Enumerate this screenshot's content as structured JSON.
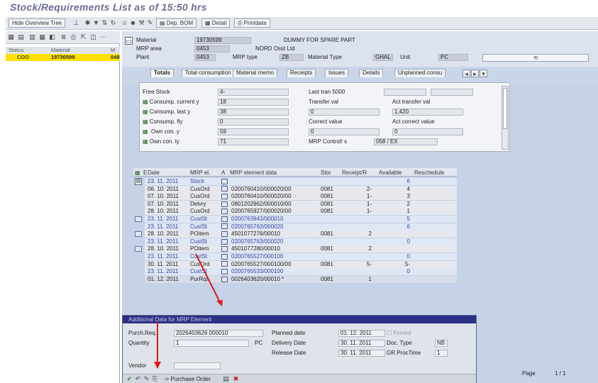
{
  "window": {
    "title": "Stock/Requirements List as of 15:50 hrs"
  },
  "toolbar": {
    "hide_overview_label": "Hide Overview Tree",
    "dep_bom_label": "Dep. BOM",
    "detail_label": "Detail",
    "printed_label": "Printdata"
  },
  "tree": {
    "col_status": "Status",
    "col_material": "Material",
    "col_m": "M",
    "row": {
      "status": "COO",
      "material": "19730599",
      "m": "048"
    }
  },
  "header": {
    "material_label": "Material",
    "material_value": "19730599",
    "material_desc": "DUMMY FOR SPARE PART",
    "mrp_area_label": "MRP area",
    "mrp_area_value": "0453",
    "mrp_area_desc": "NORD Osst Ltd",
    "plant_label": "Plant",
    "plant_value": "0453",
    "mrp_type_label": "MRP type",
    "mrp_type_value": "ZB",
    "material_type_label": "Material Type",
    "material_type_value": "GHAL",
    "unit_label": "Unit",
    "unit_value": "PC"
  },
  "tabs": [
    "Totals",
    "Total consumption",
    "Material memo",
    "Receipts",
    "Issues",
    "Details",
    "Unplanned consu"
  ],
  "totals": {
    "rows": [
      {
        "label": "Free Stock",
        "value": "4-",
        "label2": "Last tran 5000",
        "value2": ""
      },
      {
        "label": "Consump. current y",
        "value": "18",
        "label2": "Transfer val",
        "value2": "Act transfer val"
      },
      {
        "label": "Consump. last y",
        "value": "38",
        "label2": "0",
        "value2": "1,420"
      },
      {
        "label": "Consump. fly",
        "value": "0",
        "label2": "Correct value",
        "value2": "Act correct value"
      },
      {
        "label": "Own con. y",
        "value": "59",
        "label2": "0",
        "value2": "0"
      },
      {
        "label": "Own con. ly",
        "value": "71",
        "label2": "MRP Control! s",
        "value2": "058  /  EX"
      }
    ]
  },
  "grid": {
    "headers": {
      "e": "E",
      "date": "Date",
      "mrp_el": "MRP el.",
      "a": "A",
      "data": "MRP element data",
      "stor": "Stor",
      "receipt": "Receipt/R",
      "avail": "Available",
      "resched": "Reschedule"
    },
    "rows": [
      {
        "date": "23. 11. 2011",
        "mrp": "Stock",
        "data": "",
        "stor": "",
        "rec": "",
        "avail": "6",
        "blue": true
      },
      {
        "date": "06. 10. 2011",
        "mrp": "CusOrd",
        "data": "0200760410/000020/00",
        "stor": "0081",
        "rec": "2-",
        "avail": "4",
        "blue": false
      },
      {
        "date": "07. 10. 2011",
        "mrp": "CusOrd",
        "data": "0200760410/000020/00",
        "stor": "0081",
        "rec": "1-",
        "avail": "3",
        "blue": false
      },
      {
        "date": "07. 10. 2011",
        "mrp": "Delvry",
        "data": "0801202962/000010/00",
        "stor": "0081",
        "rec": "1-",
        "avail": "2",
        "blue": false
      },
      {
        "date": "28. 10. 2011",
        "mrp": "CusOrd",
        "data": "0200765927/000020/00",
        "stor": "0081",
        "rec": "1-",
        "avail": "1",
        "blue": false
      },
      {
        "date": "23. 11. 2011",
        "mrp": "CustSt",
        "data": "0200763943/000010",
        "stor": "",
        "rec": "",
        "avail": "5",
        "blue": true
      },
      {
        "date": "23. 11. 2011",
        "mrp": "CustSt",
        "data": "0200765763/000020",
        "stor": "",
        "rec": "",
        "avail": "6",
        "blue": true
      },
      {
        "date": "28. 10. 2011",
        "mrp": "POitem",
        "data": "4501077276/00010",
        "stor": "0081",
        "rec": "2",
        "avail": "",
        "blue": false
      },
      {
        "date": "23. 11. 2011",
        "mrp": "CustSt",
        "data": "0200765763/000020",
        "stor": "",
        "rec": "",
        "avail": "0",
        "blue": true
      },
      {
        "date": "28. 10. 2011",
        "mrp": "POitem",
        "data": "4501077280/00010",
        "stor": "0081",
        "rec": "2",
        "avail": "",
        "blue": false
      },
      {
        "date": "23. 11. 2011",
        "mrp": "CustSt",
        "data": "0200765527/000100",
        "stor": "",
        "rec": "",
        "avail": "0",
        "blue": true
      },
      {
        "date": "30. 11. 2011",
        "mrp": "CusOrd",
        "data": "0200765527/000100/00",
        "stor": "0081",
        "rec": "5-",
        "avail": "5-",
        "blue": false
      },
      {
        "date": "23. 11. 2011",
        "mrp": "CustSt",
        "data": "0200765533/000100",
        "stor": "",
        "rec": "",
        "avail": "0",
        "blue": true
      },
      {
        "date": "01. 12. 2011",
        "mrp": "PurRqs",
        "data": "0026403620/00010  *",
        "stor": "0081",
        "rec": "1",
        "avail": "",
        "blue": false
      }
    ]
  },
  "popup": {
    "title": "Additional Data for MRP Element",
    "purch_req_label": "Purch.Req.",
    "purch_req_value": "2026403626  000010",
    "quantity_label": "Quantity",
    "quantity_value": "1",
    "unit": "PC",
    "planned_label": "Planned date",
    "planned_value": "01. 12. 2011",
    "firmed_label": "Firmed",
    "delivery_label": "Delivery Date",
    "delivery_value": "30. 11. 2011",
    "doctype_label": "Doc. Type",
    "doctype_value": "NB",
    "release_label": "Release Date",
    "release_value": "30. 11. 2011",
    "grproc_label": "GR ProcTime",
    "grproc_value": "1",
    "vendor_label": "Vendor",
    "po_button": "-> Purchase Order"
  },
  "pager": {
    "label": "Page",
    "value": "1  /  1"
  }
}
